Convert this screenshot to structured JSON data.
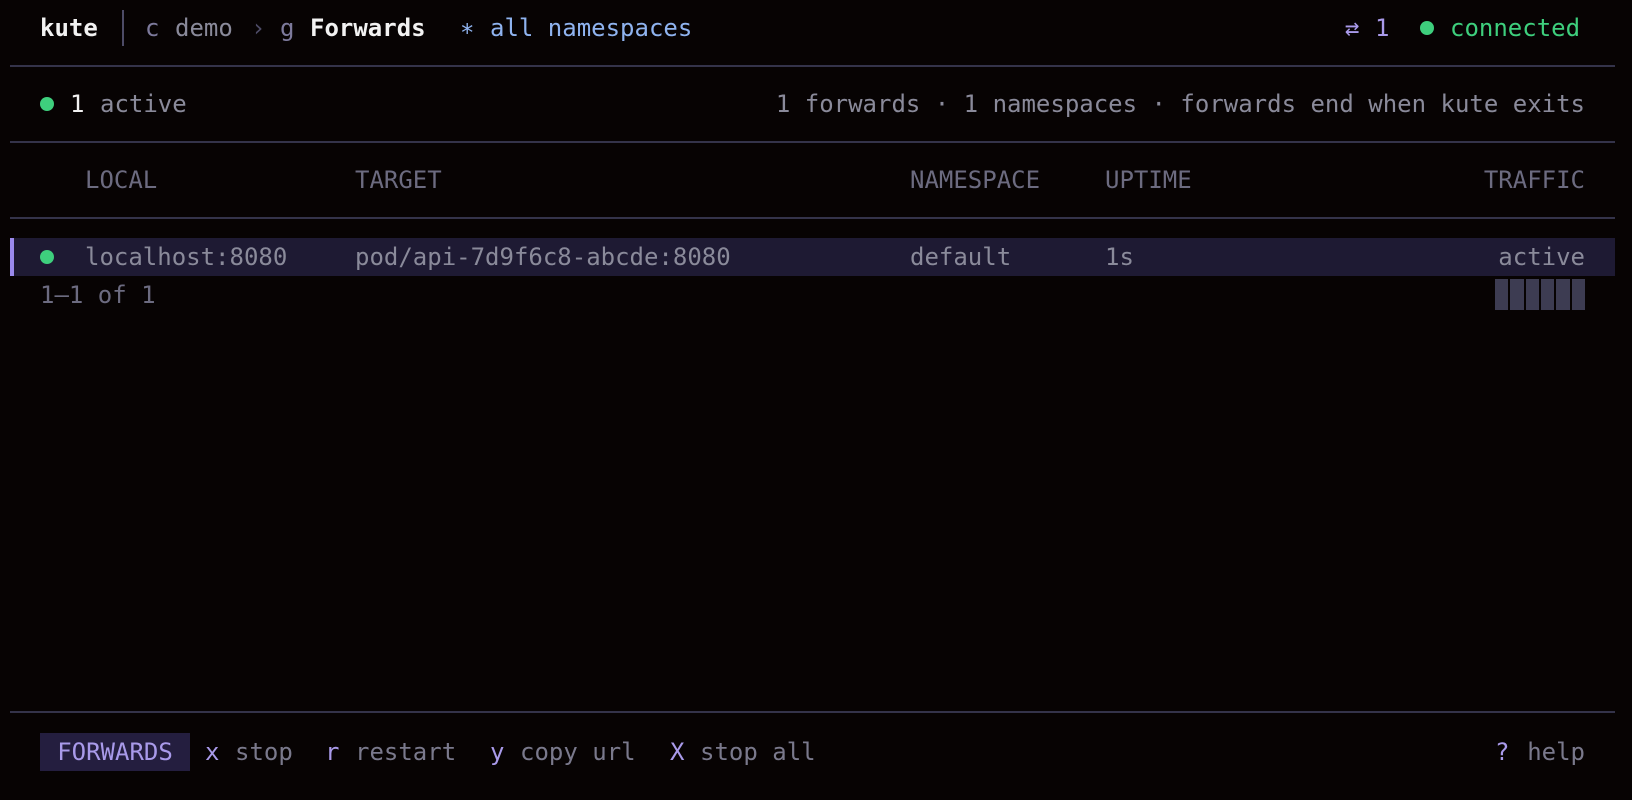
{
  "header": {
    "brand": "kute",
    "context_key": "c",
    "context": "demo",
    "crumb_sep": "›",
    "view_key": "g",
    "view": "Forwards",
    "ns_symbol": "∗",
    "namespace": "all namespaces",
    "forward_icon": "⇄",
    "forward_count": "1",
    "connection_status": "connected"
  },
  "summary": {
    "active_count": "1",
    "active_label": "active",
    "stats": "1 forwards · 1 namespaces · forwards end when kute exits"
  },
  "table": {
    "columns": [
      "LOCAL",
      "TARGET",
      "NAMESPACE",
      "UPTIME",
      "TRAFFIC"
    ],
    "rows": [
      {
        "local": "localhost:8080",
        "target": "pod/api-7d9f6c8-abcde:8080",
        "namespace": "default",
        "uptime": "1s",
        "traffic": "active",
        "selected": true
      }
    ],
    "pagination": "1–1 of 1"
  },
  "footer": {
    "mode": "FORWARDS",
    "hotkeys": [
      {
        "key": "x",
        "label": "stop"
      },
      {
        "key": "r",
        "label": "restart"
      },
      {
        "key": "y",
        "label": "copy url"
      },
      {
        "key": "X",
        "label": "stop all"
      }
    ],
    "help_key": "?",
    "help_label": "help"
  },
  "colors": {
    "background": "#070303",
    "accent": "#a99aea",
    "status_green": "#3ecf7d",
    "selected_row": "#1e1a33",
    "namespace_blue": "#8fb3ef"
  },
  "icons": {
    "status": "green-dot-icon",
    "forward": "swap-arrows-icon",
    "namespace": "asterisk-icon"
  }
}
